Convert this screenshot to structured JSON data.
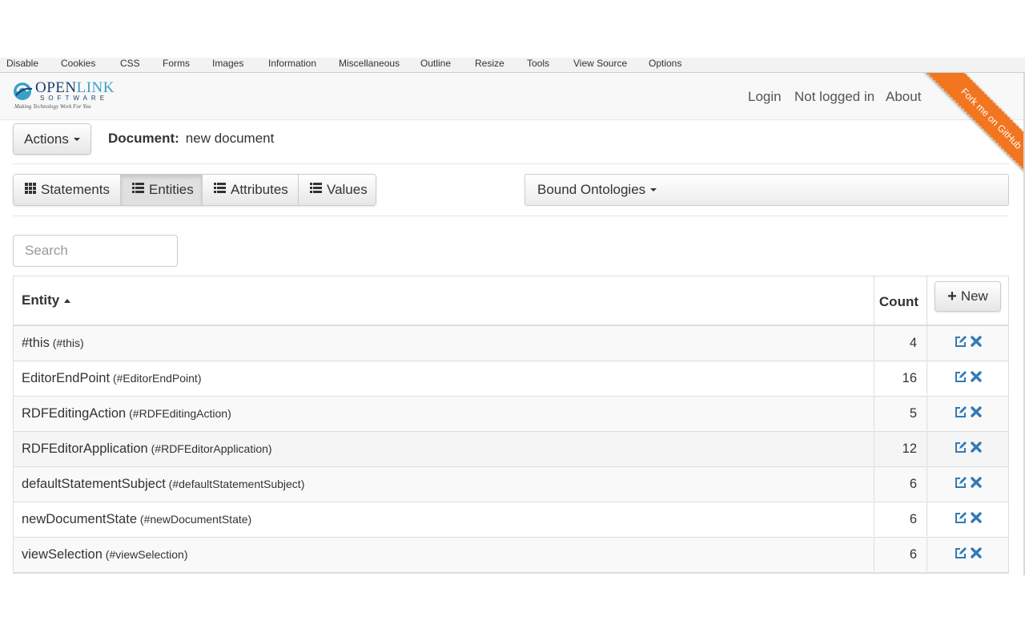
{
  "toolbar_strip": {
    "items": [
      "Disable",
      "Cookies",
      "CSS",
      "Forms",
      "Images",
      "Information",
      "Miscellaneous",
      "Outline",
      "Resize",
      "Tools",
      "View Source",
      "Options"
    ]
  },
  "navbar": {
    "logo": {
      "word1": "OPEN",
      "word2": "LINK",
      "subtitle": "SOFTWARE",
      "tagline": "Making Technology Work For You"
    },
    "links": [
      "Login",
      "Not logged in",
      "About"
    ],
    "ribbon": "Fork me on GitHub"
  },
  "toolbar": {
    "actions_label": "Actions"
  },
  "document": {
    "label": "Document:",
    "name": "new document"
  },
  "tabs": [
    {
      "label": "Statements",
      "icon": "th-icon",
      "active": false
    },
    {
      "label": "Entities",
      "icon": "list-icon",
      "active": true
    },
    {
      "label": "Attributes",
      "icon": "list-icon",
      "active": false
    },
    {
      "label": "Values",
      "icon": "list-icon",
      "active": false
    }
  ],
  "ontologies": {
    "label": "Bound Ontologies"
  },
  "search": {
    "placeholder": "Search"
  },
  "table": {
    "headers": {
      "entity": "Entity",
      "count": "Count",
      "new_button": "New"
    },
    "rows": [
      {
        "name": "#this",
        "id": "#this",
        "count": "4"
      },
      {
        "name": "EditorEndPoint",
        "id": "#EditorEndPoint",
        "count": "16"
      },
      {
        "name": "RDFEditingAction",
        "id": "#RDFEditingAction",
        "count": "5"
      },
      {
        "name": "RDFEditorApplication",
        "id": "#RDFEditorApplication",
        "count": "12"
      },
      {
        "name": "defaultStatementSubject",
        "id": "#defaultStatementSubject",
        "count": "6"
      },
      {
        "name": "newDocumentState",
        "id": "#newDocumentState",
        "count": "6"
      },
      {
        "name": "viewSelection",
        "id": "#viewSelection",
        "count": "6"
      }
    ]
  },
  "colors": {
    "accent": "#337ab7",
    "ribbon": "#f2751f",
    "brand": "#1d3d6b"
  }
}
